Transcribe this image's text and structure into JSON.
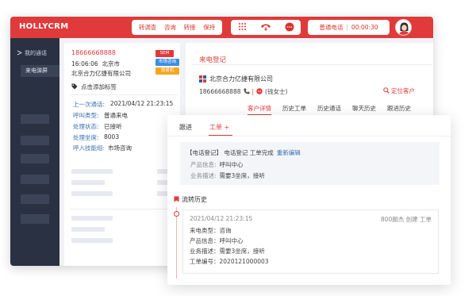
{
  "app": {
    "logo": "HOLLYCRM"
  },
  "topbar": {
    "actions": [
      "转调查",
      "咨询",
      "转接",
      "保持"
    ],
    "status_label": "普通电话",
    "timer": "00:00:30",
    "accent": "#e03a3a"
  },
  "sidebar": {
    "heading": "我的通话",
    "active_item": "来电弹屏",
    "placeholder_count": 6
  },
  "left_panel": {
    "phone": "18666668888",
    "time": "16:06:06",
    "city": "北京市",
    "company": "北京合力亿捷有限公司",
    "tags": [
      "SEM",
      "市场咨询",
      "贸易机"
    ],
    "add_tag": "点击添加标签",
    "last_call_label": "上一次通话:",
    "last_call_value": "2021/04/12 21:23:15",
    "call_type_label": "呼叫类型:",
    "call_type_value": "普通来电",
    "status_label": "处理状态:",
    "status_value": "已接听",
    "seat_label": "处理坐席:",
    "seat_value": "8003",
    "skill_label": "呼入技能组:",
    "skill_value": "市场咨询"
  },
  "right_panel": {
    "title": "来电登记",
    "company": "北京合力亿捷有限公司",
    "phone": "18666668888",
    "contact": "(钱女士)",
    "locate_label": "定位客户",
    "tabs": [
      "客户详情",
      "历史工单",
      "历史通话",
      "聊天历史",
      "跟进历史"
    ],
    "active_tab": 0
  },
  "overlay": {
    "tabs": [
      "跟进",
      "工单 +"
    ],
    "active_tab": 1,
    "summary": {
      "title": "【电话登记】 电话登记 工单完成",
      "link": "重新编辑",
      "product_label": "产品信息:",
      "product_value": "呼叫中心",
      "desc_label": "业务描述:",
      "desc_value": "需要3坐席，接听"
    },
    "history_title": "流转历史",
    "history": {
      "time": "2021/04/12 21:23:15",
      "who": "800朗杰 创建 工单",
      "rows": [
        "来电类型：咨询",
        "产品信息：呼叫中心",
        "业务描述：需要3坐席，接听",
        "工单编号：2020121000003"
      ]
    }
  },
  "icons": [
    "user-avatar-icon",
    "phone-hangup-icon",
    "chat-icon",
    "keypad-icon",
    "location-icon",
    "tag-icon",
    "company-icon",
    "bookmark-icon"
  ]
}
